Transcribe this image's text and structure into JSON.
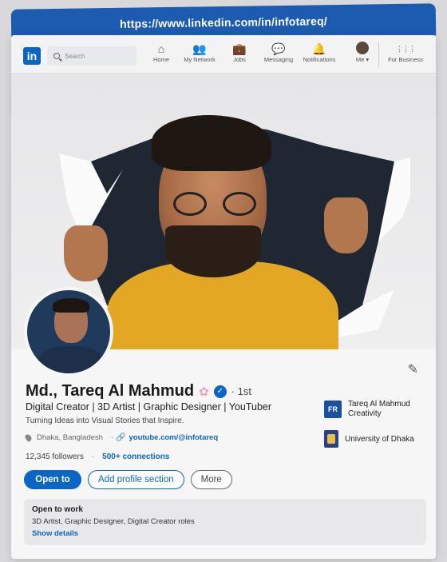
{
  "browser": {
    "url": "https://www.linkedin.com/in/infotareq/"
  },
  "nav": {
    "logo": "in",
    "search_placeholder": "Search",
    "items": [
      {
        "label": "Home",
        "icon": "home-icon",
        "glyph": "⌂"
      },
      {
        "label": "My Network",
        "icon": "network-icon",
        "glyph": "👥"
      },
      {
        "label": "Jobs",
        "icon": "jobs-icon",
        "glyph": "💼"
      },
      {
        "label": "Messaging",
        "icon": "messaging-icon",
        "glyph": "💬"
      },
      {
        "label": "Notifications",
        "icon": "bell-icon",
        "glyph": "🔔"
      },
      {
        "label": "Me ▾",
        "icon": "me-avatar",
        "glyph": ""
      },
      {
        "label": "For Business",
        "icon": "grid-icon",
        "glyph": "⋮⋮⋮"
      }
    ]
  },
  "profile": {
    "name": "Md., Tareq Al Mahmud",
    "degree": "· 1st",
    "headline": "Digital Creator | 3D Artist | Graphic Designer | YouTuber",
    "tagline": "Turning Ideas into Visual Stories that Inspire.",
    "location": "Dhaka, Bangladesh",
    "website": "youtube.com/@infotareq",
    "followers": "12,345 followers",
    "connections": "500+ connections"
  },
  "buttons": {
    "open_to": "Open to",
    "add_section": "Add profile section",
    "more": "More"
  },
  "side": {
    "company": "Tareq Al Mahmud Creativity",
    "company_logo": "FR",
    "school": "University of Dhaka"
  },
  "open_to_work": {
    "title": "Open to work",
    "roles": "3D Artist, Graphic Designer, Digital Creator roles",
    "link": "Show details"
  },
  "colors": {
    "accent": "#0a66c2",
    "shirt": "#e3a823"
  }
}
